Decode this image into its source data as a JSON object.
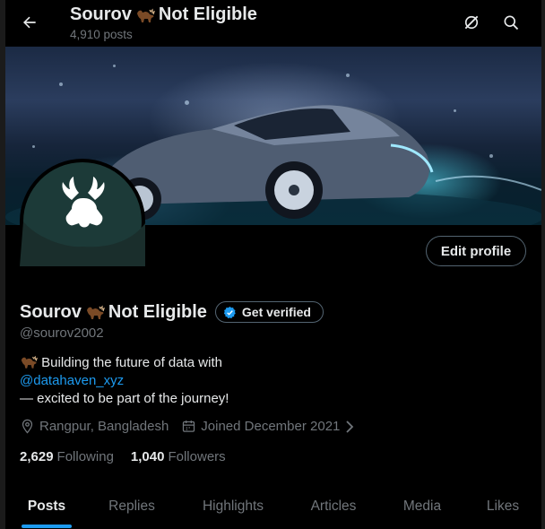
{
  "header": {
    "title": "Sourov",
    "title_suffix": "Not Eligible",
    "posts_count": "4,910 posts"
  },
  "profile": {
    "display_name": "Sourov",
    "display_name_suffix": "Not Eligible",
    "get_verified_label": "Get verified",
    "handle": "@sourov2002",
    "edit_profile_label": "Edit profile",
    "bio_line1": "Building the future of data with",
    "bio_link": "@datahaven_xyz",
    "bio_line3": "— excited to be part of the journey!",
    "location": "Rangpur, Bangladesh",
    "joined": "Joined December 2021",
    "following_count": "2,629",
    "following_label": "Following",
    "followers_count": "1,040",
    "followers_label": "Followers"
  },
  "tabs": [
    "Posts",
    "Replies",
    "Highlights",
    "Articles",
    "Media",
    "Likes"
  ],
  "colors": {
    "accent": "#1d9bf0",
    "muted": "#71767b",
    "text": "#e7e9ea",
    "avatar_bg": "#1c3a38"
  },
  "icons": {
    "back": "arrow-left-icon",
    "grok": "grok-icon",
    "search": "search-icon",
    "moose_emoji": "moose-emoji-icon",
    "verified": "verified-badge-icon",
    "location": "location-pin-icon",
    "calendar": "calendar-icon",
    "chevron": "chevron-right-icon"
  }
}
